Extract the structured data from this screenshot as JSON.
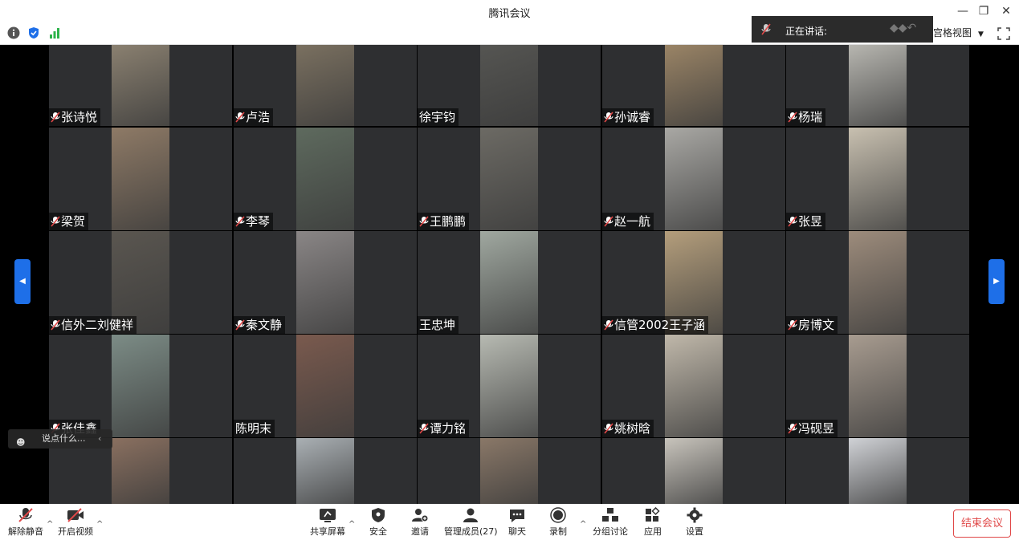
{
  "window": {
    "title": "腾讯会议"
  },
  "view": {
    "mode_label": "宫格视图"
  },
  "speaking": {
    "label": "正在讲话:"
  },
  "chat": {
    "placeholder": "说点什么..."
  },
  "participants": [
    {
      "name": "张诗悦",
      "muted": true,
      "video": "#8a8070"
    },
    {
      "name": "卢浩",
      "muted": true,
      "video": "#7a7060"
    },
    {
      "name": "徐宇钧",
      "muted": false,
      "video": "#555552"
    },
    {
      "name": "孙诚睿",
      "muted": true,
      "video": "#9a8466"
    },
    {
      "name": "杨瑞",
      "muted": true,
      "video": "#b7b6b0"
    },
    {
      "name": "梁贺",
      "muted": true,
      "video": "#8e7a66"
    },
    {
      "name": "李琴",
      "muted": true,
      "video": "#5e6a5e"
    },
    {
      "name": "王鹏鹏",
      "muted": true,
      "video": "#6c6a64"
    },
    {
      "name": "赵一航",
      "muted": true,
      "video": "#a9a8a4"
    },
    {
      "name": "张昱",
      "muted": true,
      "video": "#c8c0b0"
    },
    {
      "name": "信外二刘健祥",
      "muted": true,
      "video": "#5a5650"
    },
    {
      "name": "秦文静",
      "muted": true,
      "video": "#8a8686"
    },
    {
      "name": "王忠坤",
      "muted": false,
      "video": "#a0a8a0"
    },
    {
      "name": "信管2002王子涵",
      "muted": true,
      "video": "#b49e7c"
    },
    {
      "name": "房博文",
      "muted": true,
      "video": "#9d8c7c"
    },
    {
      "name": "张佳鑫",
      "muted": true,
      "video": "#7c8c86"
    },
    {
      "name": "陈明末",
      "muted": false,
      "video": "#7a5a4e"
    },
    {
      "name": "谭力铭",
      "muted": true,
      "video": "#b7bab2"
    },
    {
      "name": "姚树晗",
      "muted": true,
      "video": "#c0b8aa"
    },
    {
      "name": "冯砚昱",
      "muted": true,
      "video": "#a89c90"
    },
    {
      "name": "",
      "muted": false,
      "video": "#8a7060"
    },
    {
      "name": "",
      "muted": false,
      "video": "#aab0b4"
    },
    {
      "name": "",
      "muted": false,
      "video": "#8a7868"
    },
    {
      "name": "",
      "muted": false,
      "video": "#c8c4bc"
    },
    {
      "name": "",
      "muted": false,
      "video": "#d0d2d6"
    }
  ],
  "bottom": {
    "unmute": "解除静音",
    "video": "开启视频",
    "share": "共享屏幕",
    "security": "安全",
    "invite": "邀请",
    "members": "管理成员(27)",
    "chat": "聊天",
    "record": "录制",
    "breakout": "分组讨论",
    "apps": "应用",
    "settings": "设置",
    "end": "结束会议"
  },
  "colors": {
    "accent": "#1e6fe8",
    "danger": "#e04848",
    "tile": "#2e2f31"
  }
}
